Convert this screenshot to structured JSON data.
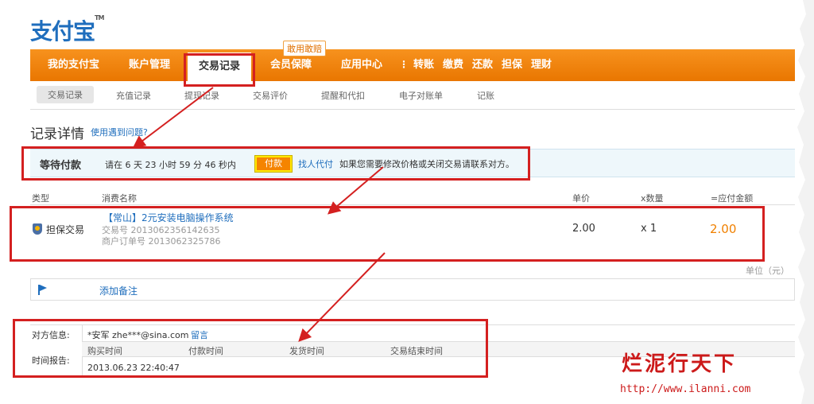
{
  "logo": {
    "text": "支付宝",
    "tm": "TM"
  },
  "nav": {
    "items": [
      "我的支付宝",
      "账户管理",
      "交易记录",
      "会员保障",
      "应用中心"
    ],
    "separator": "⋮",
    "quick_links": [
      "转账",
      "缴费",
      "还款",
      "担保",
      "理财"
    ],
    "badge": "敢用敢赔"
  },
  "subnav": {
    "items": [
      "交易记录",
      "充值记录",
      "提现记录",
      "交易评价",
      "提醒和代扣",
      "电子对账单",
      "记账"
    ]
  },
  "page": {
    "title": "记录详情",
    "help_link": "使用遇到问题?"
  },
  "status": {
    "label": "等待付款",
    "time_text": "请在 6 天 23 小时 59 分 46 秒内",
    "pay_button": "付款",
    "proxy_link": "找人代付",
    "hint": "如果您需要修改价格或关闭交易请联系对方。"
  },
  "table": {
    "headers": [
      "类型",
      "消费名称",
      "单价",
      "x数量",
      "=应付金额"
    ],
    "row": {
      "type": "担保交易",
      "product": "【常山】2元安装电脑操作系统",
      "trade_no": "交易号 2013062356142635",
      "merchant_no": "商户订单号 2013062325786",
      "unit_price": "2.00",
      "quantity": "x 1",
      "total": "2.00"
    },
    "unit_note": "单位（元）"
  },
  "remark": {
    "link": "添加备注"
  },
  "info": {
    "counterpart_label": "对方信息:",
    "counterpart": "*安军 zhe***@sina.com",
    "message_link": "留言",
    "time_report_label": "时间报告:",
    "time_headers": [
      "购买时间",
      "付款时间",
      "发货时间",
      "交易结束时间"
    ],
    "buy_time": "2013.06.23 22:40:47"
  },
  "watermark": {
    "text": "烂泥行天下",
    "url": "http://www.ilanni.com"
  },
  "colors": {
    "nav_orange": "#f08200",
    "link_blue": "#1f6ebd",
    "annotation_red": "#d42020",
    "amount_orange": "#f08000"
  }
}
